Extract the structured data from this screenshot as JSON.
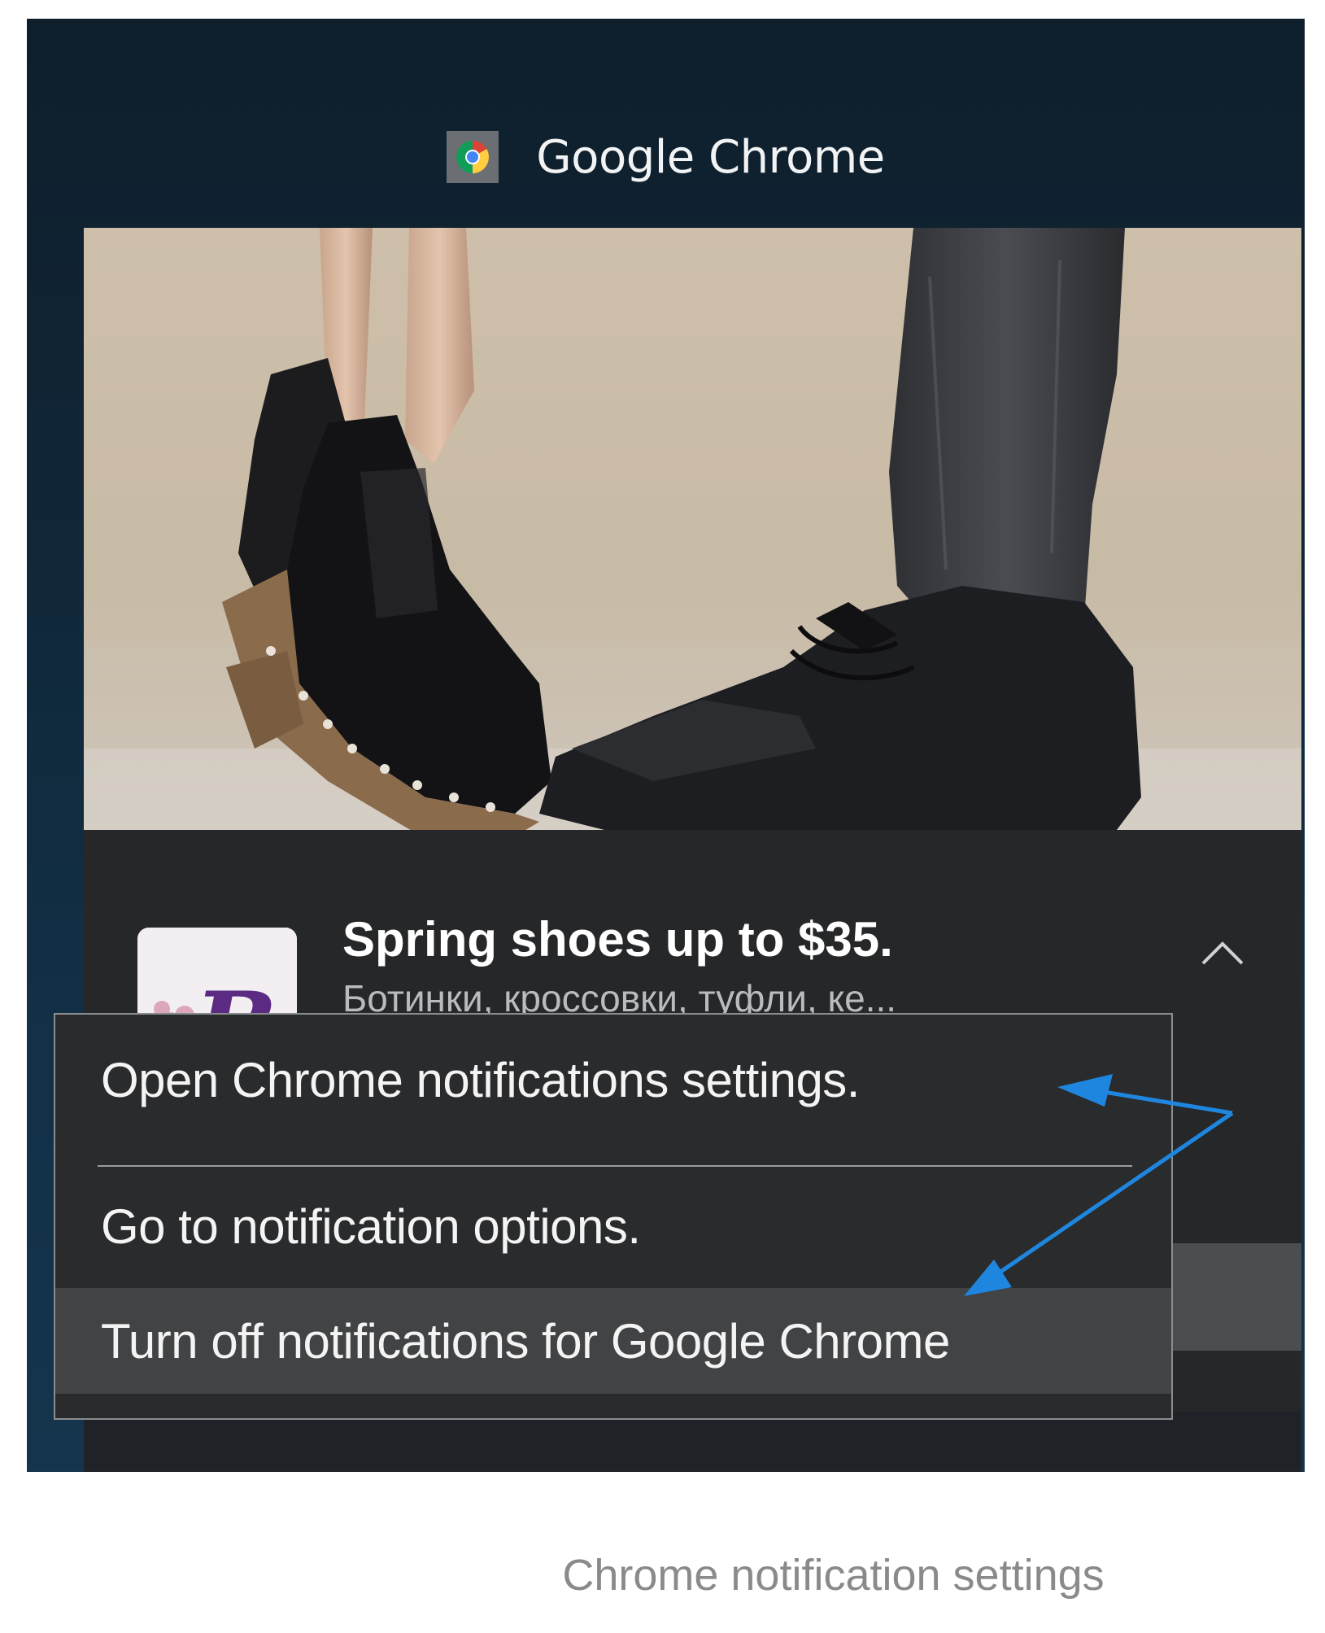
{
  "header": {
    "app_name": "Google Chrome",
    "app_icon": "chrome-icon"
  },
  "notification": {
    "title": "Spring shoes up to $35.",
    "body_partial": "Ботинки, кроссовки, туфли, ке...",
    "logo_letter": "B",
    "hero_image": "two pairs of black boots on a beige background",
    "collapse_icon": "chevron-up-icon"
  },
  "context_menu": {
    "items": [
      {
        "label": "Open Chrome notifications settings."
      },
      {
        "label": "Go to notification options."
      },
      {
        "label": "Turn off notifications for Google Chrome"
      }
    ],
    "highlighted_index": 2
  },
  "annotation": {
    "arrow_color": "#1f86e0"
  },
  "caption": "Chrome notification settings",
  "colors": {
    "panel_bg": "#12283a",
    "card_bg": "#252729",
    "menu_bg": "#2a2b2d",
    "menu_highlight": "#414345",
    "caption_text": "#8a8a8a"
  }
}
